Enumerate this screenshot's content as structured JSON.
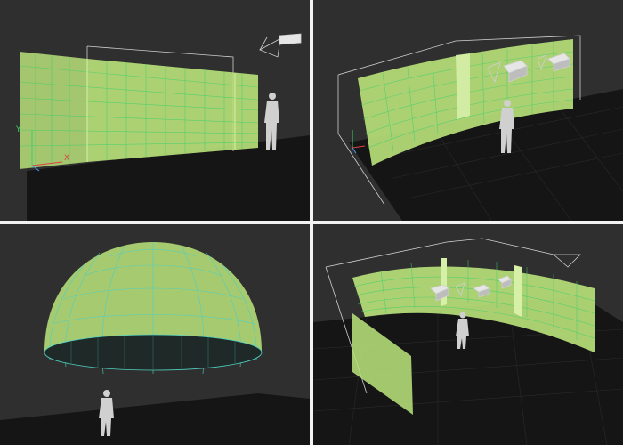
{
  "axis": {
    "y_label": "Y",
    "x_label": "X"
  },
  "colors": {
    "viewport_bg": "#2f2f2f",
    "floor": "#151515",
    "floor_grid": "#3a3a3a",
    "screen_fill": "#b7e07a",
    "screen_line": "#3fcf6a",
    "dome_line": "#4fd0c0",
    "outline": "#cfcfcf",
    "figure": "#d0d0d0"
  },
  "icons": {
    "figure": "human-figure-icon",
    "projector": "projector-icon",
    "axis_gizmo": "axis-gizmo-icon"
  }
}
